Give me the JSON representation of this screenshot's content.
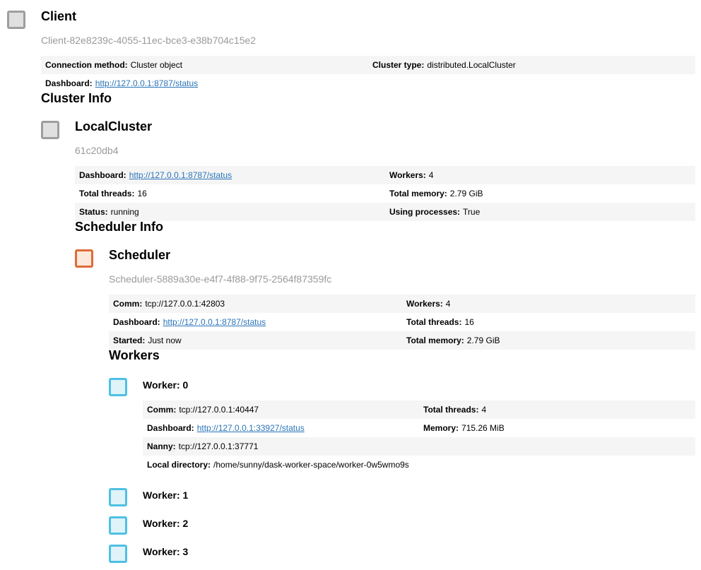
{
  "client": {
    "title": "Client",
    "id": "Client-82e8239c-4055-11ec-bce3-e38b704c15e2",
    "connection_method_label": "Connection method:",
    "connection_method_value": "Cluster object",
    "cluster_type_label": "Cluster type:",
    "cluster_type_value": "distributed.LocalCluster",
    "dashboard_label": "Dashboard:",
    "dashboard_link": "http://127.0.0.1:8787/status"
  },
  "cluster_info": {
    "heading": "Cluster Info",
    "title": "LocalCluster",
    "id": "61c20db4",
    "dashboard_label": "Dashboard:",
    "dashboard_link": "http://127.0.0.1:8787/status",
    "workers_label": "Workers:",
    "workers_value": "4",
    "total_threads_label": "Total threads:",
    "total_threads_value": "16",
    "total_memory_label": "Total memory:",
    "total_memory_value": "2.79 GiB",
    "status_label": "Status:",
    "status_value": "running",
    "using_processes_label": "Using processes:",
    "using_processes_value": "True"
  },
  "scheduler_info": {
    "heading": "Scheduler Info",
    "title": "Scheduler",
    "id": "Scheduler-5889a30e-e4f7-4f88-9f75-2564f87359fc",
    "comm_label": "Comm:",
    "comm_value": "tcp://127.0.0.1:42803",
    "workers_label": "Workers:",
    "workers_value": "4",
    "dashboard_label": "Dashboard:",
    "dashboard_link": "http://127.0.0.1:8787/status",
    "total_threads_label": "Total threads:",
    "total_threads_value": "16",
    "started_label": "Started:",
    "started_value": "Just now",
    "total_memory_label": "Total memory:",
    "total_memory_value": "2.79 GiB"
  },
  "workers": {
    "heading": "Workers",
    "items": [
      {
        "title": "Worker: 0",
        "comm_label": "Comm:",
        "comm_value": "tcp://127.0.0.1:40447",
        "total_threads_label": "Total threads:",
        "total_threads_value": "4",
        "dashboard_label": "Dashboard:",
        "dashboard_link": "http://127.0.0.1:33927/status",
        "memory_label": "Memory:",
        "memory_value": "715.26 MiB",
        "nanny_label": "Nanny:",
        "nanny_value": "tcp://127.0.0.1:37771",
        "local_dir_label": "Local directory:",
        "local_dir_value": "/home/sunny/dask-worker-space/worker-0w5wmo9s"
      },
      {
        "title": "Worker: 1"
      },
      {
        "title": "Worker: 2"
      },
      {
        "title": "Worker: 3"
      }
    ]
  },
  "icons": {
    "client": "client-icon",
    "cluster": "cluster-icon",
    "scheduler": "scheduler-icon",
    "worker": "worker-icon"
  },
  "colors": {
    "client_icon": "#9e9e9e",
    "scheduler_icon": "#e06a38",
    "worker_icon": "#4fc0e3",
    "link": "#2a74b8",
    "row_shade": "#f5f5f5"
  }
}
